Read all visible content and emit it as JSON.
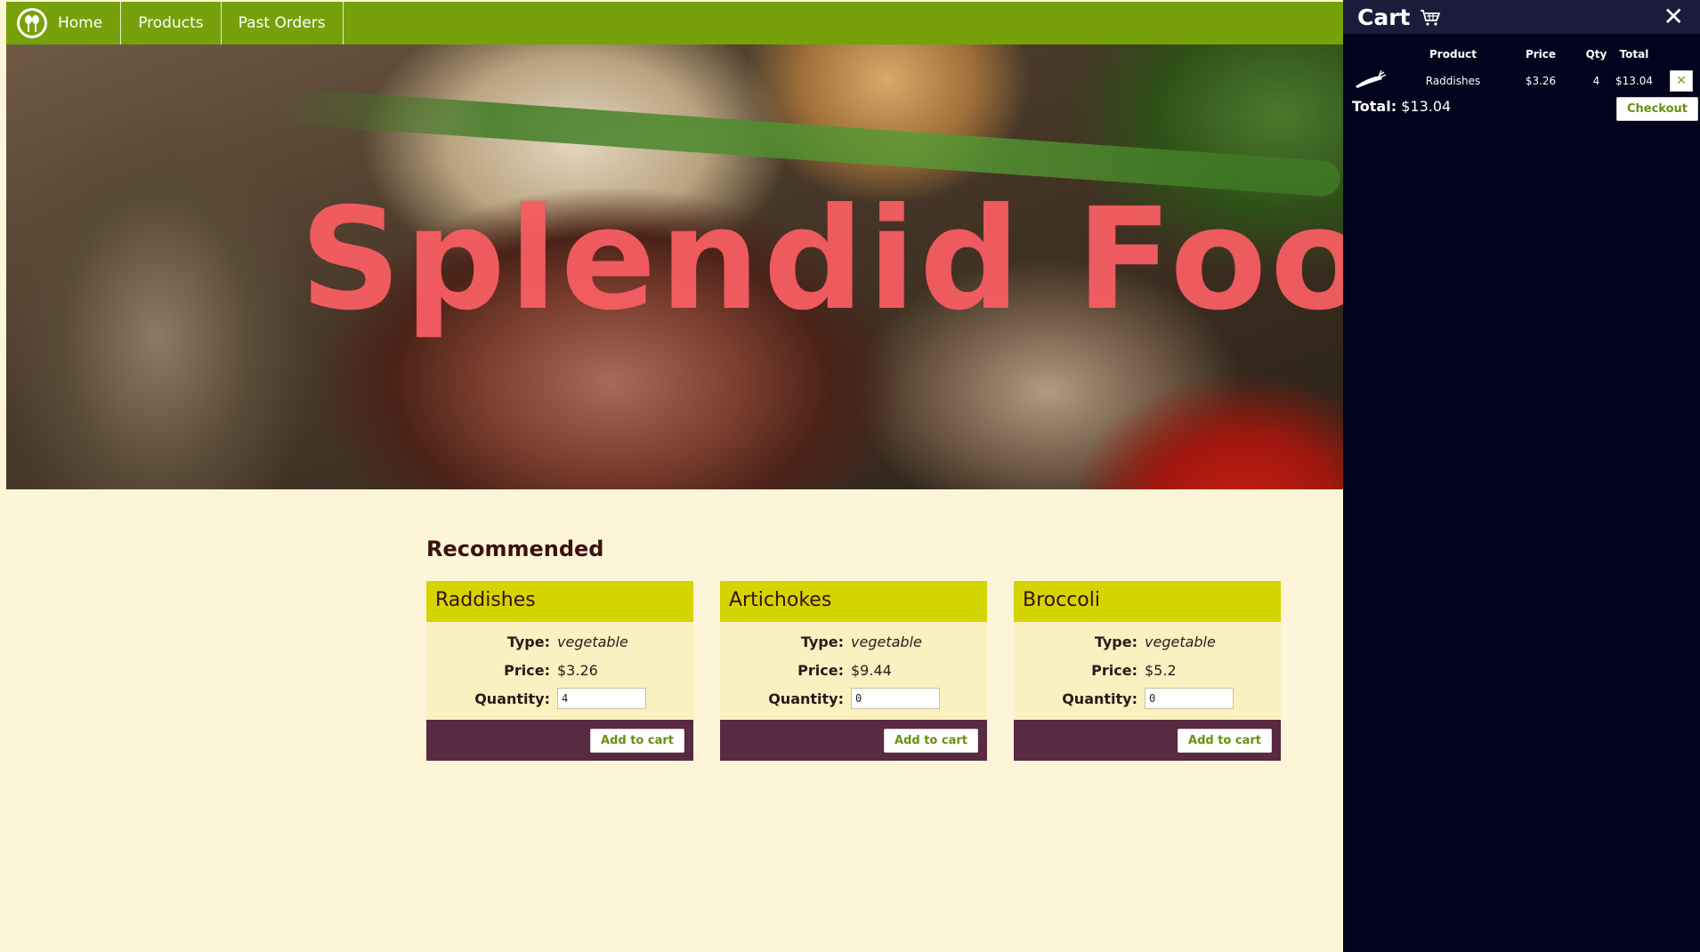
{
  "nav": {
    "items": [
      {
        "label": "Home"
      },
      {
        "label": "Products"
      },
      {
        "label": "Past Orders"
      }
    ]
  },
  "hero": {
    "title": "Splendid Food"
  },
  "recommended": {
    "title": "Recommended",
    "type_label": "Type:",
    "price_label": "Price:",
    "quantity_label": "Quantity:",
    "add_label": "Add to cart",
    "products": [
      {
        "name": "Raddishes",
        "type": "vegetable",
        "price": "$3.26",
        "quantity": "4"
      },
      {
        "name": "Artichokes",
        "type": "vegetable",
        "price": "$9.44",
        "quantity": "0"
      },
      {
        "name": "Broccoli",
        "type": "vegetable",
        "price": "$5.2",
        "quantity": "0"
      }
    ]
  },
  "cart": {
    "title": "Cart",
    "close_glyph": "✕",
    "columns": {
      "product": "Product",
      "price": "Price",
      "qty": "Qty",
      "total": "Total"
    },
    "items": [
      {
        "product": "Raddishes",
        "price": "$3.26",
        "qty": "4",
        "total": "$13.04",
        "remove_glyph": "✕"
      }
    ],
    "total_label": "Total:",
    "total_value": "$13.04",
    "checkout_label": "Checkout"
  },
  "colors": {
    "nav": "#76a10a",
    "card_head": "#d4d400",
    "card_foot": "#5a2942",
    "cart_bg": "#03031e",
    "page_bg": "#fdf5d8"
  }
}
